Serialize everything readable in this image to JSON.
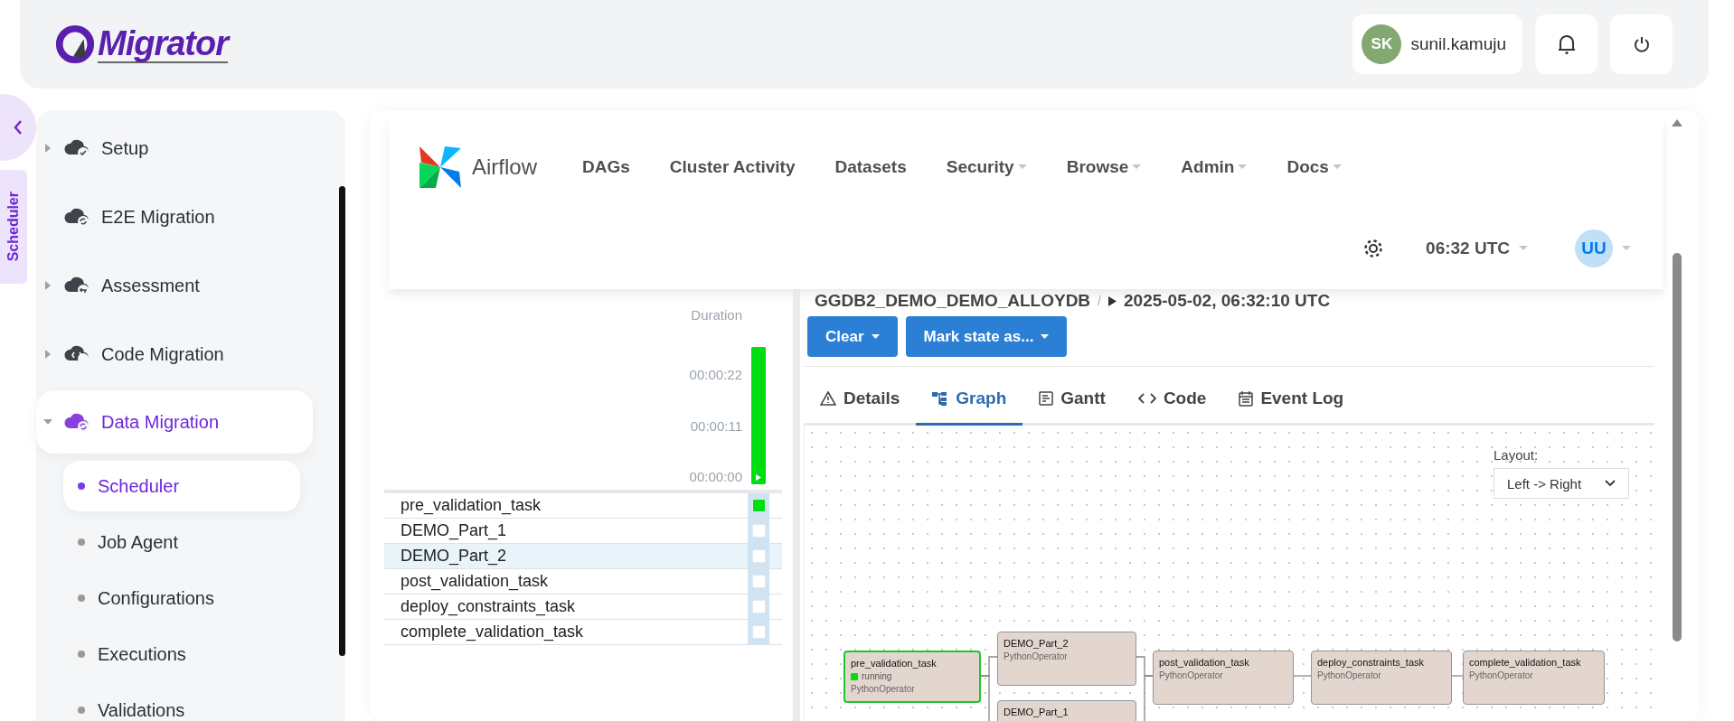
{
  "header": {
    "logo": "Migrator",
    "user": {
      "initials": "SK",
      "name": "sunil.kamuju"
    }
  },
  "side_tab": "Scheduler",
  "sidebar": {
    "items": [
      {
        "label": "Setup",
        "kind": "group",
        "expanded": false,
        "selected": false
      },
      {
        "label": "E2E Migration",
        "kind": "item",
        "selected": false
      },
      {
        "label": "Assessment",
        "kind": "group",
        "expanded": false,
        "selected": false
      },
      {
        "label": "Code Migration",
        "kind": "group",
        "expanded": false,
        "selected": false
      },
      {
        "label": "Data Migration",
        "kind": "group",
        "expanded": true,
        "selected": true,
        "children": [
          {
            "label": "Scheduler",
            "selected": true
          },
          {
            "label": "Job Agent",
            "selected": false
          },
          {
            "label": "Configurations",
            "selected": false
          },
          {
            "label": "Executions",
            "selected": false
          },
          {
            "label": "Validations",
            "selected": false
          }
        ]
      }
    ]
  },
  "airflow": {
    "brand": "Airflow",
    "nav": [
      {
        "label": "DAGs",
        "dropdown": false
      },
      {
        "label": "Cluster Activity",
        "dropdown": false
      },
      {
        "label": "Datasets",
        "dropdown": false
      },
      {
        "label": "Security",
        "dropdown": true
      },
      {
        "label": "Browse",
        "dropdown": true
      },
      {
        "label": "Admin",
        "dropdown": true
      },
      {
        "label": "Docs",
        "dropdown": true
      }
    ],
    "time": "06:32 UTC",
    "user": "UU"
  },
  "grid": {
    "duration_label": "Duration",
    "ticks": [
      "00:00:22",
      "00:00:11",
      "00:00:00"
    ],
    "run_bar": {
      "level": 1
    },
    "tasks": [
      {
        "name": "pre_validation_task",
        "running": true,
        "highlighted": false
      },
      {
        "name": "DEMO_Part_1",
        "running": false,
        "highlighted": false
      },
      {
        "name": "DEMO_Part_2",
        "running": false,
        "highlighted": true
      },
      {
        "name": "post_validation_task",
        "running": false,
        "highlighted": false
      },
      {
        "name": "deploy_constraints_task",
        "running": false,
        "highlighted": false
      },
      {
        "name": "complete_validation_task",
        "running": false,
        "highlighted": false
      }
    ]
  },
  "breadcrumb": {
    "dag": "GGDB2_DEMO_DEMO_ALLOYDB",
    "separator": "/",
    "run": "2025-05-02, 06:32:10 UTC"
  },
  "buttons": [
    "Clear",
    "Mark state as..."
  ],
  "tabs": [
    {
      "label": "Details",
      "selected": false
    },
    {
      "label": "Graph",
      "selected": true
    },
    {
      "label": "Gantt",
      "selected": false
    },
    {
      "label": "Code",
      "selected": false
    },
    {
      "label": "Event Log",
      "selected": false
    }
  ],
  "graph": {
    "layout_label": "Layout:",
    "layout_value": "Left -> Right",
    "nodes": [
      {
        "name": "pre_validation_task",
        "running": true,
        "status_text": "running",
        "operator": "PythonOperator"
      },
      {
        "name": "DEMO_Part_2",
        "running": false,
        "operator": "PythonOperator"
      },
      {
        "name": "post_validation_task",
        "running": false,
        "operator": "PythonOperator"
      },
      {
        "name": "deploy_constraints_task",
        "running": false,
        "operator": "PythonOperator"
      },
      {
        "name": "complete_validation_task",
        "running": false,
        "operator": "PythonOperator"
      },
      {
        "name": "DEMO_Part_1",
        "running": false
      }
    ]
  }
}
